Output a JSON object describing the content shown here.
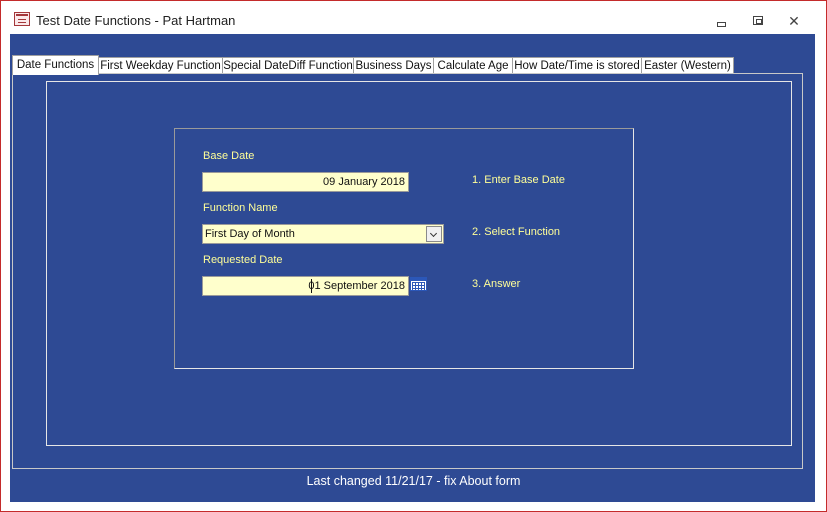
{
  "window": {
    "title": "Test Date Functions - Pat Hartman",
    "app_icon": "access-form-icon",
    "controls": {
      "minimize_icon": "minimize-icon",
      "restore_icon": "restore-icon",
      "close_glyph": "✕"
    }
  },
  "colors": {
    "form_background": "#2e4a94",
    "label_text": "#ffff99",
    "field_background": "#ffffcc"
  },
  "tabs": [
    {
      "label": "Date Functions",
      "active": true
    },
    {
      "label": "First Weekday Function",
      "active": false
    },
    {
      "label": "Special DateDiff Function",
      "active": false
    },
    {
      "label": "Business Days",
      "active": false
    },
    {
      "label": "Calculate Age",
      "active": false
    },
    {
      "label": "How Date/Time is stored",
      "active": false
    },
    {
      "label": "Easter (Western)",
      "active": false
    }
  ],
  "form": {
    "base_date": {
      "label": "Base Date",
      "value": "09 January 2018",
      "hint": "1. Enter Base Date"
    },
    "function_name": {
      "label": "Function Name",
      "value": "First Day of Month",
      "hint": "2. Select Function"
    },
    "requested_date": {
      "label": "Requested Date",
      "value": "01 September 2018",
      "hint": "3. Answer",
      "picker_icon": "calendar-icon"
    }
  },
  "footer": {
    "text": "Last changed 11/21/17 - fix About form"
  }
}
